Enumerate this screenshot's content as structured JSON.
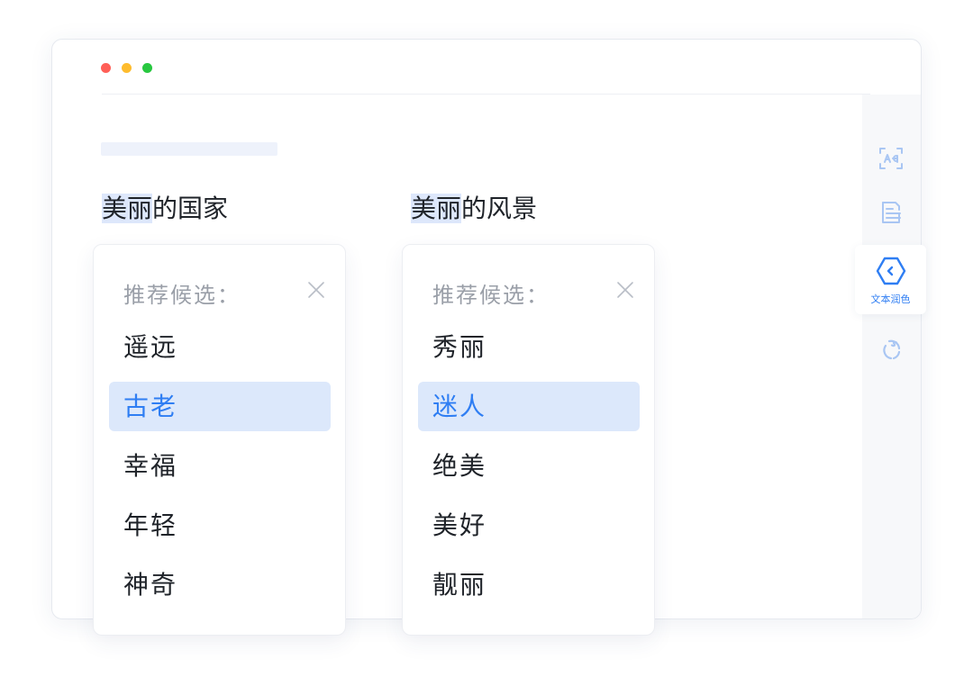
{
  "headings": {
    "first": {
      "highlight": "美丽",
      "rest": "的国家"
    },
    "second": {
      "highlight": "美丽",
      "rest": "的风景"
    }
  },
  "panels": [
    {
      "label": "推荐候选：",
      "options": [
        "遥远",
        "古老",
        "幸福",
        "年轻",
        "神奇"
      ],
      "selected_index": 1
    },
    {
      "label": "推荐候选：",
      "options": [
        "秀丽",
        "迷人",
        "绝美",
        "美好",
        "靓丽"
      ],
      "selected_index": 1
    }
  ],
  "sidebar": {
    "items": [
      {
        "icon": "text-recognition-icon"
      },
      {
        "icon": "document-icon"
      },
      {
        "icon": "text-polish-icon",
        "label": "文本润色",
        "active": true
      },
      {
        "icon": "rewrite-icon"
      }
    ]
  },
  "colors": {
    "accent": "#2f7ef3",
    "selected_bg": "#dce8fb",
    "highlight_bg": "#dde7fb",
    "icon_light": "#a9c6f3"
  }
}
